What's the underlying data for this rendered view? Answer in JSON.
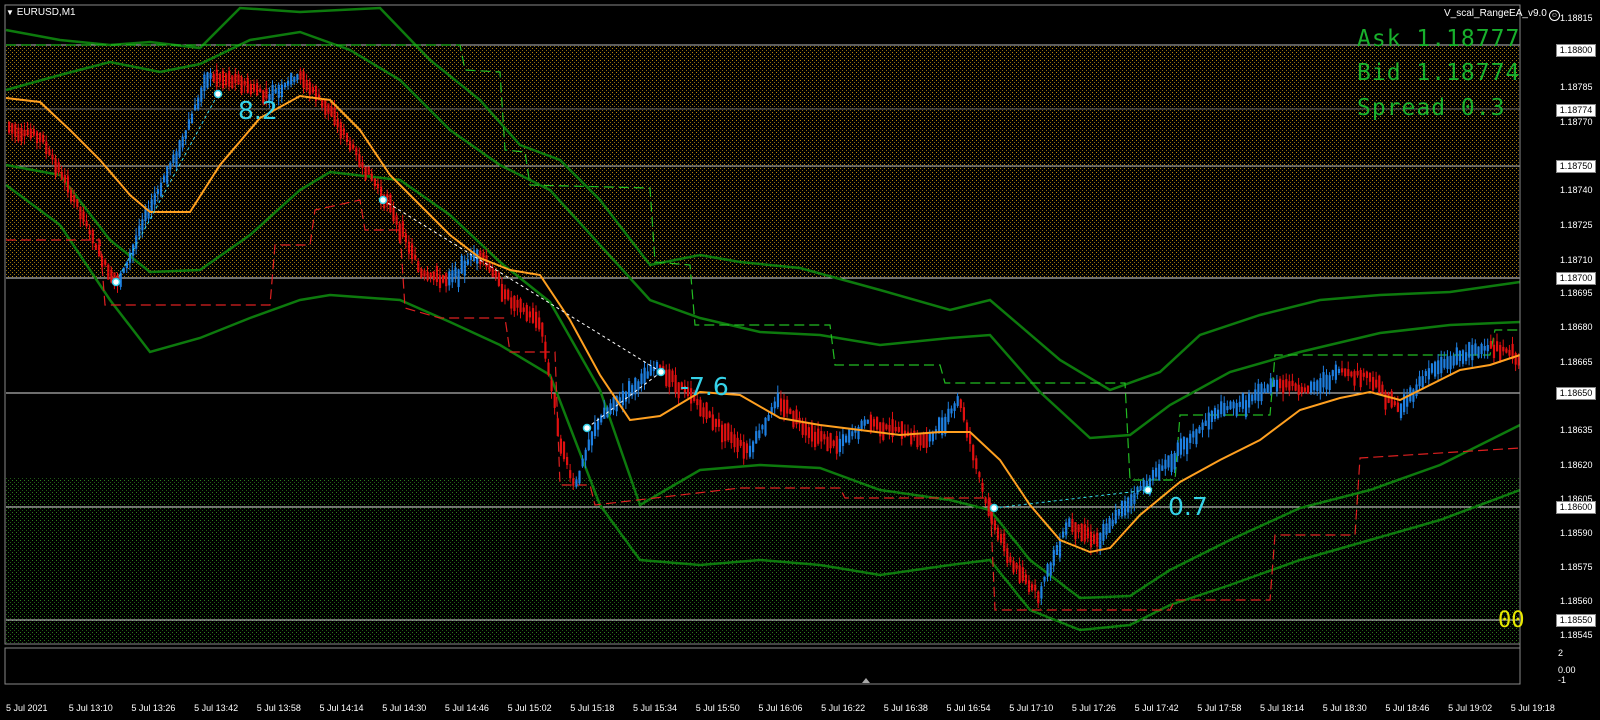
{
  "window": {
    "symbol": "EURUSD,M1",
    "ea_name": "V_scal_RangeEA_v9.0",
    "smiley": "☺"
  },
  "quotes": {
    "ask": "Ask 1.18777",
    "bid": "Bid 1.18774",
    "spread": "Spread 0.3"
  },
  "trade_labels": {
    "first": "8.2",
    "second": "-7.6",
    "third": "0.7"
  },
  "zero_counter": "00",
  "price_axis": {
    "labels": [
      "1.18815",
      "1.18785",
      "1.18770",
      "1.18740",
      "1.18725",
      "1.18710",
      "1.18695",
      "1.18680",
      "1.18665",
      "1.18635",
      "1.18620",
      "1.18605",
      "1.18590",
      "1.18575",
      "1.18560",
      "1.18545"
    ],
    "boxes": [
      "1.18800",
      "1.18774",
      "1.18750",
      "1.18700",
      "1.18650",
      "1.18600",
      "1.18550"
    ]
  },
  "time_axis": [
    "5 Jul 2021",
    "5 Jul 13:10",
    "5 Jul 13:26",
    "5 Jul 13:42",
    "5 Jul 13:58",
    "5 Jul 14:14",
    "5 Jul 14:30",
    "5 Jul 14:46",
    "5 Jul 15:02",
    "5 Jul 15:18",
    "5 Jul 15:34",
    "5 Jul 15:50",
    "5 Jul 16:06",
    "5 Jul 16:22",
    "5 Jul 16:38",
    "5 Jul 16:54",
    "5 Jul 17:10",
    "5 Jul 17:26",
    "5 Jul 17:42",
    "5 Jul 17:58",
    "5 Jul 18:14",
    "5 Jul 18:30",
    "5 Jul 18:46",
    "5 Jul 19:02",
    "5 Jul 19:18"
  ],
  "subwindow_axis": [
    "2",
    "0.00",
    "-1"
  ],
  "colors": {
    "bull": "#1e7fe0",
    "bear": "#e01010",
    "ma": "#ffa020",
    "band": "#0d7a0d",
    "quote": "#18b02c"
  }
}
